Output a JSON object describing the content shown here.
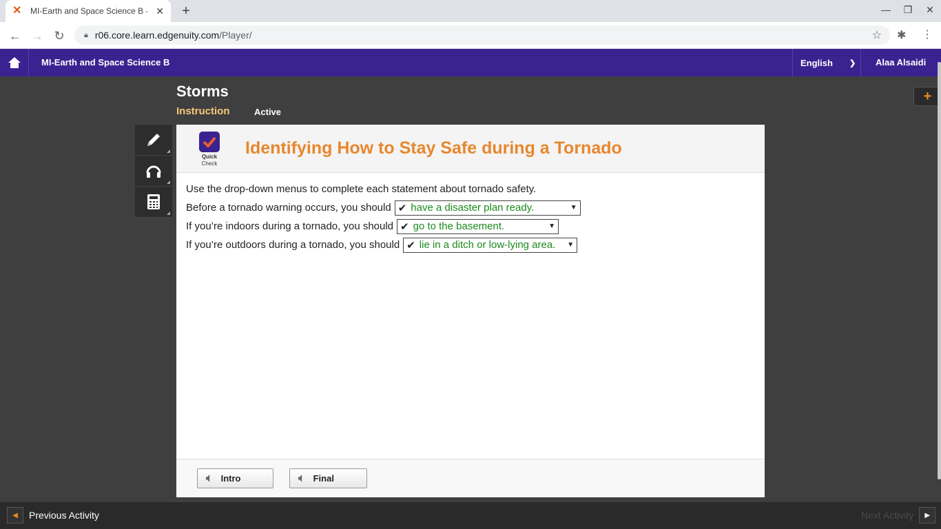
{
  "browser": {
    "tab_title": "MI-Earth and Space Science B - Edgenuity",
    "url_host": "r06.core.learn.edgenuity.com",
    "url_path": "/Player/"
  },
  "app": {
    "course_title": "MI-Earth and Space Science B",
    "language": "English",
    "user_name": "Alaa Alsaidi",
    "brand_color": "#3a2390",
    "accent_color": "#e8872d"
  },
  "lesson": {
    "title": "Storms",
    "tab_instruction": "Instruction",
    "status": "Active"
  },
  "activity": {
    "badge_line1": "Quick",
    "badge_line2": "Check",
    "title": "Identifying How to Stay Safe during a Tornado",
    "instructions": "Use the drop-down menus to complete each statement about tornado safety.",
    "statements": [
      {
        "prompt": "Before a tornado warning occurs, you should",
        "answer": "have a disaster plan ready."
      },
      {
        "prompt": "If you’re indoors during a tornado, you should",
        "answer": "go to the basement."
      },
      {
        "prompt": "If you’re outdoors during a tornado, you should",
        "answer": "lie in a ditch or low-lying area."
      }
    ],
    "check_mark": "✔"
  },
  "footer": {
    "intro_label": "Intro",
    "final_label": "Final"
  },
  "navigation": {
    "previous_label": "Previous Activity",
    "next_label": "Next Activity"
  },
  "tools": [
    "pencil-icon",
    "headphones-icon",
    "calculator-icon"
  ]
}
